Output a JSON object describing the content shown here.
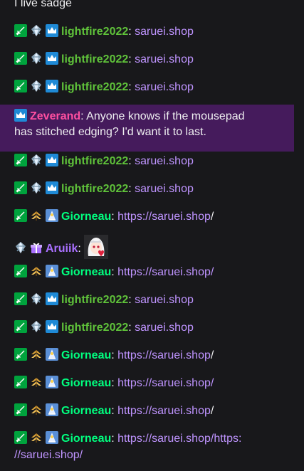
{
  "colors": {
    "background": "#18181b",
    "lightfire": "#5fc23a",
    "zeverand": "#ff4fa0",
    "giorneau": "#00ff7f",
    "aruiik": "#a970ff",
    "link": "#bf94ff",
    "highlight": "#451b5c"
  },
  "messages": [
    {
      "type": "partial",
      "text": "I live sadge"
    },
    {
      "type": "msg",
      "user": "lightfire2022",
      "color": "#5fc23a",
      "badges": [
        "sword",
        "diamond",
        "crown"
      ],
      "segments": [
        {
          "kind": "link",
          "text": "saruei.shop"
        }
      ]
    },
    {
      "type": "msg",
      "user": "lightfire2022",
      "color": "#5fc23a",
      "badges": [
        "sword",
        "diamond",
        "crown"
      ],
      "segments": [
        {
          "kind": "link",
          "text": "saruei.shop"
        }
      ]
    },
    {
      "type": "msg",
      "user": "lightfire2022",
      "color": "#5fc23a",
      "badges": [
        "sword",
        "diamond",
        "crown"
      ],
      "segments": [
        {
          "kind": "link",
          "text": "saruei.shop"
        }
      ]
    },
    {
      "type": "highlight",
      "user": "Zeverand",
      "color": "#ff4fa0",
      "badges": [
        "crown"
      ],
      "text_line1": "Anyone knows if the mousepad",
      "text_line2": "has stitched edging? I'd want it to last."
    },
    {
      "type": "msg",
      "user": "lightfire2022",
      "color": "#5fc23a",
      "badges": [
        "sword",
        "diamond",
        "crown"
      ],
      "segments": [
        {
          "kind": "link",
          "text": "saruei.shop"
        }
      ]
    },
    {
      "type": "msg",
      "user": "lightfire2022",
      "color": "#5fc23a",
      "badges": [
        "sword",
        "diamond",
        "crown"
      ],
      "segments": [
        {
          "kind": "link",
          "text": "saruei.shop"
        }
      ]
    },
    {
      "type": "msg",
      "user": "Giorneau",
      "color": "#00ff7f",
      "badges": [
        "sword",
        "chevron",
        "sub"
      ],
      "segments": [
        {
          "kind": "link",
          "text": "https://saruei.shop"
        },
        {
          "kind": "plain",
          "text": "/"
        }
      ]
    },
    {
      "type": "emote",
      "user": "Aruiik",
      "color": "#a970ff",
      "badges": [
        "diamond",
        "gift"
      ],
      "emote": "anime-girl-heart-emote"
    },
    {
      "type": "msg",
      "user": "Giorneau",
      "color": "#00ff7f",
      "badges": [
        "sword",
        "chevron",
        "sub"
      ],
      "segments": [
        {
          "kind": "link",
          "text": "https://saruei.shop/"
        }
      ]
    },
    {
      "type": "msg",
      "user": "lightfire2022",
      "color": "#5fc23a",
      "badges": [
        "sword",
        "diamond",
        "crown"
      ],
      "segments": [
        {
          "kind": "link",
          "text": "saruei.shop"
        }
      ]
    },
    {
      "type": "msg",
      "user": "lightfire2022",
      "color": "#5fc23a",
      "badges": [
        "sword",
        "diamond",
        "crown"
      ],
      "segments": [
        {
          "kind": "link",
          "text": "saruei.shop"
        }
      ]
    },
    {
      "type": "msg",
      "user": "Giorneau",
      "color": "#00ff7f",
      "badges": [
        "sword",
        "chevron",
        "sub"
      ],
      "segments": [
        {
          "kind": "link",
          "text": "https://saruei.shop"
        },
        {
          "kind": "plain",
          "text": "/"
        }
      ]
    },
    {
      "type": "msg",
      "user": "Giorneau",
      "color": "#00ff7f",
      "badges": [
        "sword",
        "chevron",
        "sub"
      ],
      "segments": [
        {
          "kind": "link",
          "text": "https://saruei.shop/"
        }
      ]
    },
    {
      "type": "msg",
      "user": "Giorneau",
      "color": "#00ff7f",
      "badges": [
        "sword",
        "chevron",
        "sub"
      ],
      "segments": [
        {
          "kind": "link",
          "text": "https://saruei.shop"
        },
        {
          "kind": "plain",
          "text": "/"
        }
      ]
    },
    {
      "type": "wrap",
      "user": "Giorneau",
      "color": "#00ff7f",
      "badges": [
        "sword",
        "chevron",
        "sub"
      ],
      "line1": "https://saruei.shop/https:",
      "line2": "//saruei.shop/"
    }
  ]
}
